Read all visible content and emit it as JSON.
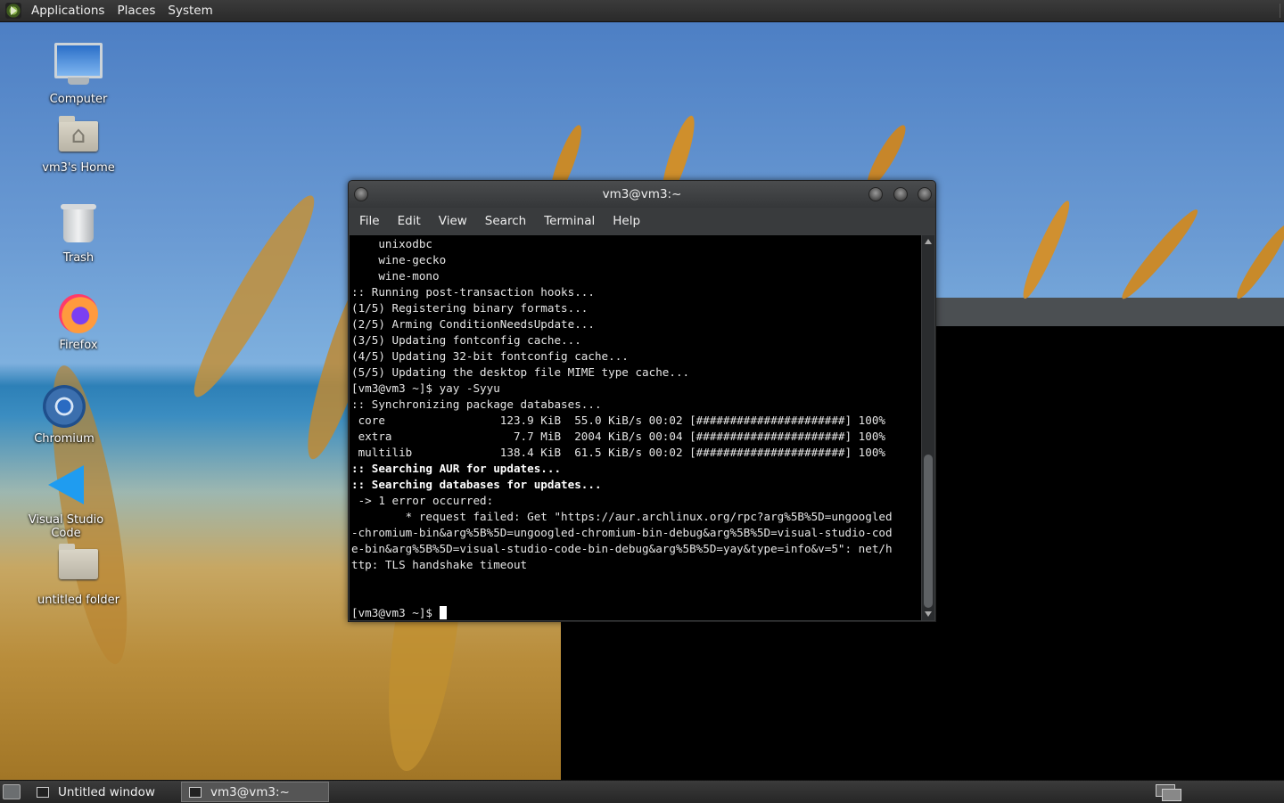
{
  "top_panel": {
    "menus": [
      "Applications",
      "Places",
      "System"
    ]
  },
  "desktop_icons": [
    {
      "label": "Computer",
      "icon": "computer-icon"
    },
    {
      "label": "vm3's Home",
      "icon": "home-folder-icon"
    },
    {
      "label": "Trash",
      "icon": "trash-icon"
    },
    {
      "label": "Firefox",
      "icon": "firefox-icon"
    },
    {
      "label": "Chromium",
      "icon": "chromium-icon"
    },
    {
      "label": "Visual Studio Code",
      "icon": "vscode-icon"
    },
    {
      "label": "untitled folder",
      "icon": "folder-icon"
    }
  ],
  "terminal": {
    "title": "vm3@vm3:~",
    "menu": [
      "File",
      "Edit",
      "View",
      "Search",
      "Terminal",
      "Help"
    ],
    "lines": [
      "    unixodbc",
      "    wine-gecko",
      "    wine-mono",
      ":: Running post-transaction hooks...",
      "(1/5) Registering binary formats...",
      "(2/5) Arming ConditionNeedsUpdate...",
      "(3/5) Updating fontconfig cache...",
      "(4/5) Updating 32-bit fontconfig cache...",
      "(5/5) Updating the desktop file MIME type cache...",
      "[vm3@vm3 ~]$ yay -Syyu",
      ":: Synchronizing package databases...",
      " core                 123.9 KiB  55.0 KiB/s 00:02 [######################] 100%",
      " extra                  7.7 MiB  2004 KiB/s 00:04 [######################] 100%",
      " multilib             138.4 KiB  61.5 KiB/s 00:02 [######################] 100%",
      ":: Searching AUR for updates...",
      ":: Searching databases for updates...",
      " -> 1 error occurred:",
      "        * request failed: Get \"https://aur.archlinux.org/rpc?arg%5B%5D=ungoogled",
      "-chromium-bin&arg%5B%5D=ungoogled-chromium-bin-debug&arg%5B%5D=visual-studio-cod",
      "e-bin&arg%5B%5D=visual-studio-code-bin-debug&arg%5B%5D=yay&type=info&v=5\": net/h",
      "ttp: TLS handshake timeout",
      "",
      ""
    ],
    "bold_lines": [
      14,
      15
    ],
    "prompt": "[vm3@vm3 ~]$ "
  },
  "taskbar": {
    "tasks": [
      {
        "label": "Untitled window",
        "active": false
      },
      {
        "label": "vm3@vm3:~",
        "active": true
      }
    ]
  }
}
